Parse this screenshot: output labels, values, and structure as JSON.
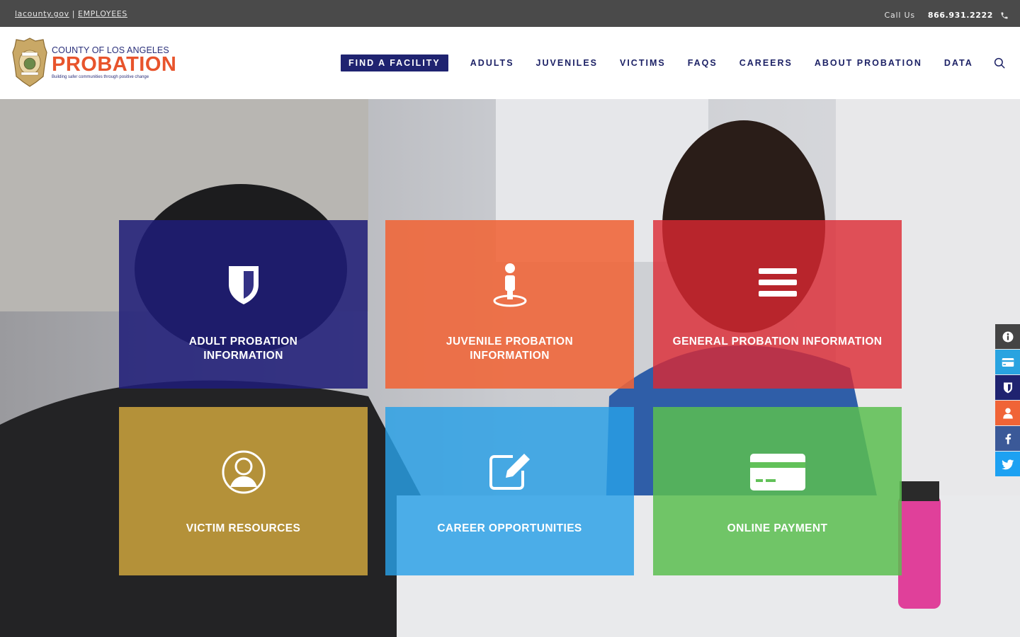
{
  "topbar": {
    "lacounty_link": "lacounty.gov",
    "separator": "|",
    "employees_link": "EMPLOYEES",
    "call_label": "Call Us",
    "phone": "866.931.2222"
  },
  "header": {
    "logo": {
      "county": "COUNTY OF LOS ANGELES",
      "name": "PROBATION",
      "tagline": "Building safer communities through positive change"
    },
    "nav": [
      {
        "label": "FIND A FACILITY"
      },
      {
        "label": "ADULTS"
      },
      {
        "label": "JUVENILES"
      },
      {
        "label": "VICTIMS"
      },
      {
        "label": "FAQS"
      },
      {
        "label": "CAREERS"
      },
      {
        "label": "ABOUT PROBATION"
      },
      {
        "label": "DATA"
      }
    ]
  },
  "tiles": [
    {
      "label": "ADULT PROBATION INFORMATION",
      "icon": "shield-icon",
      "color": "#1e1c78"
    },
    {
      "label": "JUVENILE PROBATION INFORMATION",
      "icon": "person-pin-icon",
      "color": "#f06437"
    },
    {
      "label": "GENERAL PROBATION INFORMATION",
      "icon": "menu-lines-icon",
      "color": "#dc2832"
    },
    {
      "label": "VICTIM RESOURCES",
      "icon": "user-circle-icon",
      "color": "#c8a03c"
    },
    {
      "label": "CAREER OPPORTUNITIES",
      "icon": "edit-icon",
      "color": "#28a0e6"
    },
    {
      "label": "ONLINE PAYMENT",
      "icon": "credit-card-icon",
      "color": "#5abe50"
    }
  ],
  "side_buttons": [
    {
      "icon": "info-icon",
      "color": "#444444"
    },
    {
      "icon": "credit-card-icon",
      "color": "#29a3e0"
    },
    {
      "icon": "shield-icon",
      "color": "#1f2370"
    },
    {
      "icon": "user-icon",
      "color": "#f06437"
    },
    {
      "icon": "facebook-icon",
      "color": "#3b5998"
    },
    {
      "icon": "twitter-icon",
      "color": "#1da1f2"
    }
  ]
}
